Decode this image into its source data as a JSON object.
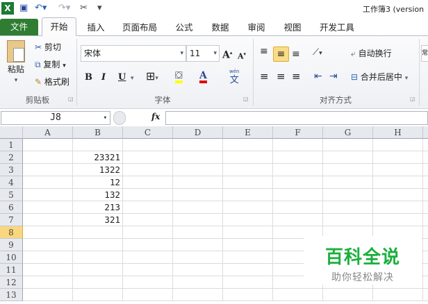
{
  "title_bar": {
    "title": "工作簿3 (version",
    "qat_icons": [
      "excel-icon",
      "save-icon",
      "undo-icon",
      "redo-icon",
      "tools-icon",
      "customize-icon"
    ]
  },
  "tabs": [
    "文件",
    "开始",
    "插入",
    "页面布局",
    "公式",
    "数据",
    "审阅",
    "视图",
    "开发工具"
  ],
  "ribbon": {
    "clipboard": {
      "paste": "粘贴",
      "cut": "剪切",
      "copy": "复制",
      "format_painter": "格式刷",
      "label": "剪贴板"
    },
    "font": {
      "name": "宋体",
      "size": "11",
      "bold": "B",
      "italic": "I",
      "underline": "U",
      "font_color_letter": "A",
      "phonetic": "文",
      "phonetic_top": "wén",
      "label": "字体"
    },
    "alignment": {
      "wrap": "自动换行",
      "merge": "合并后居中",
      "label": "对齐方式"
    },
    "number_format_partial": "常"
  },
  "formula_bar": {
    "name_box": "J8",
    "fx": "fx",
    "value": ""
  },
  "sheet": {
    "columns": [
      "A",
      "B",
      "C",
      "D",
      "E",
      "F",
      "G",
      "H"
    ],
    "rows": [
      "1",
      "2",
      "3",
      "4",
      "5",
      "6",
      "7",
      "8",
      "9",
      "10",
      "11",
      "12",
      "13"
    ],
    "selected_row": "8",
    "column_b_values": [
      "",
      "23321",
      "1322",
      "12",
      "132",
      "213",
      "321"
    ]
  },
  "watermark": {
    "title": "百科全说",
    "subtitle": "助你轻松解决",
    "color": "#1aaf3c"
  },
  "colors": {
    "file_tab": "#2f7d32",
    "highlight_fill": "#ffff00",
    "font_color": "#e00000",
    "selected_header": "#f9d77e"
  }
}
